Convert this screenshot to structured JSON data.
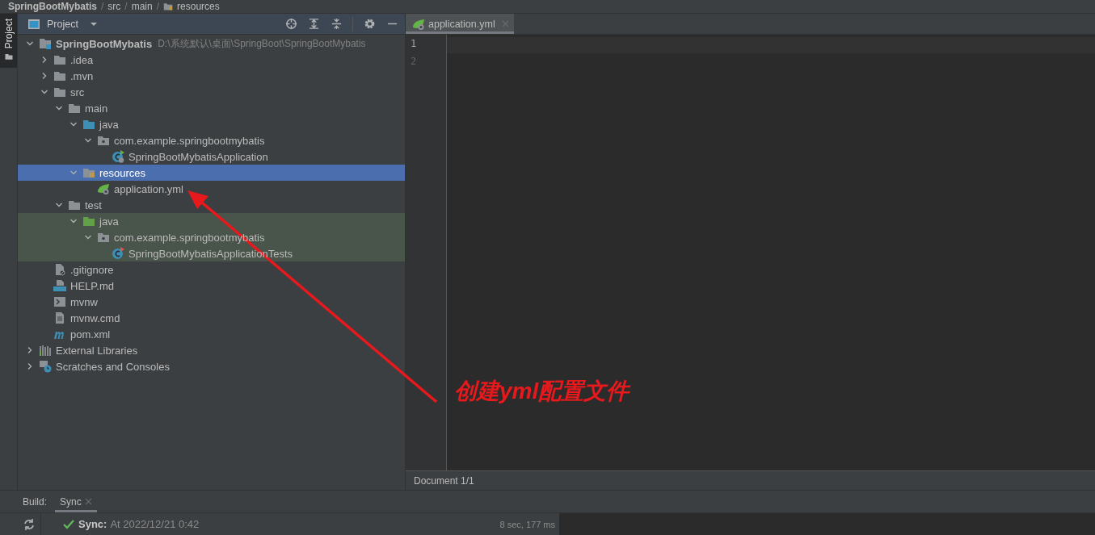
{
  "breadcrumb": [
    {
      "kind": "crumb",
      "text": "SpringBootMybatis"
    },
    {
      "kind": "separator",
      "text": "/"
    },
    {
      "kind": "crumb",
      "text": "src"
    },
    {
      "kind": "separator",
      "text": "/"
    },
    {
      "kind": "crumb",
      "text": "main"
    },
    {
      "kind": "separator",
      "text": "/"
    },
    {
      "kind": "folder-crumb",
      "text": "resources"
    }
  ],
  "tool_strip": {
    "label": "Project",
    "selected": true
  },
  "project_panel": {
    "title": "Project",
    "tree": [
      {
        "kind": "module",
        "label": "SpringBootMybatis",
        "path": "D:\\系统默认\\桌面\\SpringBoot\\SpringBootMybatis",
        "expanded": true,
        "selected": false,
        "test_source": false,
        "children": [
          {
            "kind": "folder",
            "label": ".idea",
            "expanded": false,
            "selected": false,
            "test_source": false
          },
          {
            "kind": "folder",
            "label": ".mvn",
            "expanded": false,
            "selected": false,
            "test_source": false
          },
          {
            "kind": "folder",
            "label": "src",
            "expanded": true,
            "selected": false,
            "test_source": false,
            "children": [
              {
                "kind": "folder",
                "label": "main",
                "expanded": true,
                "selected": false,
                "test_source": false,
                "children": [
                  {
                    "kind": "source-folder",
                    "label": "java",
                    "expanded": true,
                    "selected": false,
                    "test_source": false,
                    "children": [
                      {
                        "kind": "package",
                        "label": "com.example.springbootmybatis",
                        "expanded": true,
                        "selected": false,
                        "test_source": false,
                        "children": [
                          {
                            "kind": "spring-class",
                            "label": "SpringBootMybatisApplication",
                            "selected": false,
                            "test_source": false
                          }
                        ]
                      }
                    ]
                  },
                  {
                    "kind": "resources-folder",
                    "label": "resources",
                    "expanded": true,
                    "selected": true,
                    "test_source": false,
                    "children": [
                      {
                        "kind": "yml",
                        "label": "application.yml",
                        "selected": false,
                        "test_source": false
                      }
                    ]
                  }
                ]
              },
              {
                "kind": "folder",
                "label": "test",
                "expanded": true,
                "selected": false,
                "test_source": false,
                "children": [
                  {
                    "kind": "test-folder",
                    "label": "java",
                    "expanded": true,
                    "selected": false,
                    "test_source": true,
                    "children": [
                      {
                        "kind": "package",
                        "label": "com.example.springbootmybatis",
                        "expanded": true,
                        "selected": false,
                        "test_source": true,
                        "children": [
                          {
                            "kind": "test-class",
                            "label": "SpringBootMybatisApplicationTests",
                            "selected": false,
                            "test_source": true
                          }
                        ]
                      }
                    ]
                  }
                ]
              }
            ]
          },
          {
            "kind": "gitignore",
            "label": ".gitignore",
            "selected": false,
            "test_source": false
          },
          {
            "kind": "markdown",
            "label": "HELP.md",
            "selected": false,
            "test_source": false
          },
          {
            "kind": "shell",
            "label": "mvnw",
            "selected": false,
            "test_source": false
          },
          {
            "kind": "text",
            "label": "mvnw.cmd",
            "selected": false,
            "test_source": false
          },
          {
            "kind": "maven",
            "label": "pom.xml",
            "selected": false,
            "test_source": false
          }
        ]
      },
      {
        "kind": "libraries",
        "label": "External Libraries",
        "expanded": false,
        "selected": false,
        "test_source": false
      },
      {
        "kind": "scratches",
        "label": "Scratches and Consoles",
        "expanded": false,
        "selected": false,
        "test_source": false
      }
    ]
  },
  "editor": {
    "tabs": [
      {
        "label": "application.yml",
        "selected": true
      }
    ],
    "line_numbers": [
      "1",
      "2"
    ],
    "status": "Document 1/1"
  },
  "build": {
    "label": "Build:",
    "tabs": [
      {
        "label": "Sync",
        "selected": true
      }
    ],
    "result": {
      "title": "Sync:",
      "text": "At 2022/12/21 0:42",
      "duration": "8 sec, 177 ms"
    }
  },
  "annotation": {
    "text": "创建yml配置文件"
  }
}
